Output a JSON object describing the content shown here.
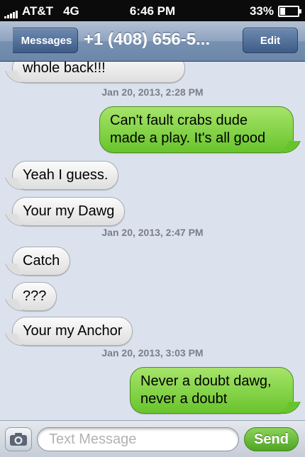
{
  "status_bar": {
    "carrier": "AT&T",
    "network": "4G",
    "time": "6:46 PM",
    "battery_percent_label": "33%",
    "battery_level": 0.33,
    "signal_bars": 5
  },
  "navbar": {
    "back_label": "Messages",
    "title": "+1 (408) 656-5...",
    "edit_label": "Edit"
  },
  "messages": [
    {
      "from": "them",
      "text": "whole back!!!"
    },
    {
      "timestamp": "Jan 20, 2013, 2:28 PM"
    },
    {
      "from": "me",
      "text_lines": [
        "Can't fault crabs dude",
        "made a play. It's all good"
      ]
    },
    {
      "from": "them",
      "text": "Yeah I guess."
    },
    {
      "from": "them",
      "text": "Your my Dawg"
    },
    {
      "timestamp": "Jan 20, 2013, 2:47 PM"
    },
    {
      "from": "them",
      "text": "Catch"
    },
    {
      "from": "them",
      "text": "???"
    },
    {
      "from": "them",
      "text": "Your my Anchor"
    },
    {
      "timestamp": "Jan 20, 2013, 3:03 PM"
    },
    {
      "from": "me",
      "text_lines": [
        "Never a doubt dawg,",
        "never a doubt"
      ]
    }
  ],
  "input_bar": {
    "camera_icon": "camera-icon",
    "placeholder": "Text Message",
    "send_label": "Send"
  },
  "colors": {
    "sent_bubble": "#68c42c",
    "received_bubble": "#dedede",
    "navbar": "#7690b1",
    "background": "#dbe2ed"
  }
}
